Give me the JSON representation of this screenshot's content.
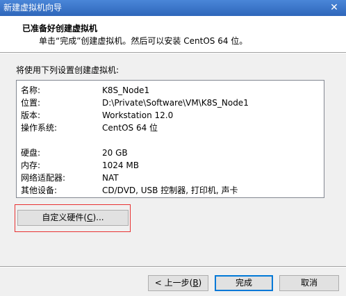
{
  "window": {
    "title": "新建虚拟机向导",
    "close_glyph": "✕"
  },
  "header": {
    "heading": "已准备好创建虚拟机",
    "subheading": "单击“完成”创建虚拟机。然后可以安装 CentOS 64 位。"
  },
  "intro": "将使用下列设置创建虚拟机:",
  "summary": {
    "rows": [
      {
        "label": "名称:",
        "value": "K8S_Node1"
      },
      {
        "label": "位置:",
        "value": "D:\\Private\\Software\\VM\\K8S_Node1"
      },
      {
        "label": "版本:",
        "value": "Workstation 12.0"
      },
      {
        "label": "操作系统:",
        "value": "CentOS 64 位"
      },
      {
        "label": "硬盘:",
        "value": "20 GB"
      },
      {
        "label": "内存:",
        "value": "1024 MB"
      },
      {
        "label": "网络适配器:",
        "value": "NAT"
      },
      {
        "label": "其他设备:",
        "value": "CD/DVD, USB 控制器, 打印机, 声卡"
      }
    ]
  },
  "buttons": {
    "customize": {
      "prefix": "自定义硬件(",
      "key": "C",
      "suffix": ")..."
    },
    "back": {
      "prefix": "< 上一步(",
      "key": "B",
      "suffix": ")"
    },
    "finish": "完成",
    "cancel": "取消"
  }
}
